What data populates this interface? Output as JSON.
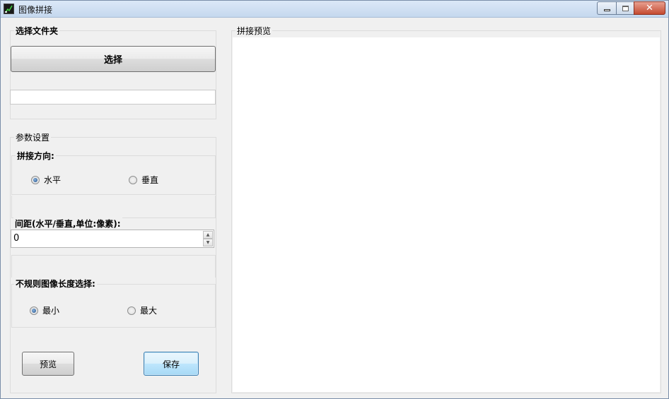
{
  "window": {
    "title": "图像拼接",
    "controls": {
      "close_glyph": "✕"
    }
  },
  "folder": {
    "group_label": "选择文件夹",
    "select_button": "选择",
    "path_value": ""
  },
  "params": {
    "group_label": "参数设置",
    "direction": {
      "label": "拼接方向:",
      "options": [
        {
          "label": "水平",
          "checked": true
        },
        {
          "label": "垂直",
          "checked": false
        }
      ]
    },
    "spacing": {
      "label": "间距(水平/垂直,单位:像素):",
      "value": "0",
      "up_glyph": "▲",
      "down_glyph": "▼"
    },
    "irregular": {
      "label": "不规则图像长度选择:",
      "options": [
        {
          "label": "最小",
          "checked": true
        },
        {
          "label": "最大",
          "checked": false
        }
      ]
    }
  },
  "actions": {
    "preview_button": "预览",
    "save_button": "保存"
  },
  "preview": {
    "group_label": "拼接预览"
  },
  "icons": {
    "app": "image-stitch-app-icon",
    "minimize": "minimize-icon",
    "maximize": "maximize-icon",
    "close": "close-icon"
  }
}
